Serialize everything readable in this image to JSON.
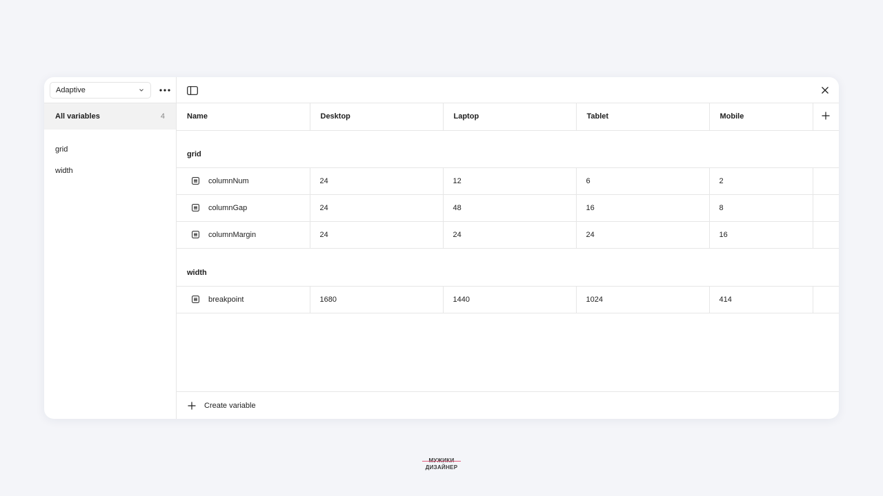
{
  "sidebar": {
    "collection_select": {
      "value": "Adaptive"
    },
    "all_variables": {
      "label": "All variables",
      "count": "4"
    },
    "groups": [
      {
        "label": "grid"
      },
      {
        "label": "width"
      }
    ]
  },
  "table": {
    "headers": [
      "Name",
      "Desktop",
      "Laptop",
      "Tablet",
      "Mobile"
    ],
    "groups": [
      {
        "name": "grid",
        "rows": [
          {
            "name": "columnNum",
            "values": [
              "24",
              "12",
              "6",
              "2"
            ]
          },
          {
            "name": "columnGap",
            "values": [
              "24",
              "48",
              "16",
              "8"
            ]
          },
          {
            "name": "columnMargin",
            "values": [
              "24",
              "24",
              "24",
              "16"
            ]
          }
        ]
      },
      {
        "name": "width",
        "rows": [
          {
            "name": "breakpoint",
            "values": [
              "1680",
              "1440",
              "1024",
              "414"
            ]
          }
        ]
      }
    ]
  },
  "footer": {
    "create_label": "Create variable"
  },
  "logo": {
    "line1": "МУЖИКИ",
    "line2": "ДИЗАЙНЕР"
  },
  "icons": {
    "more": "more-horizontal-icon",
    "toggle_sidebar": "sidebar-toggle-icon",
    "close": "close-icon",
    "add": "plus-icon",
    "variable": "number-variable-icon"
  },
  "colors": {
    "background": "#f4f5f9",
    "panel": "#ffffff",
    "border": "#e6e6e6",
    "selected": "#f2f2f2",
    "text": "#1e1e1e"
  }
}
